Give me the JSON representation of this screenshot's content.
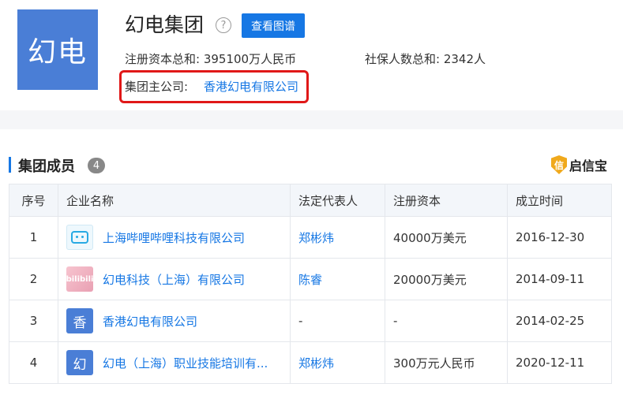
{
  "header": {
    "logo_text": "幻电",
    "title": "幻电集团",
    "graph_button": "查看图谱",
    "registered_capital": "注册资本总和: 395100万人民币",
    "social_insurance": "社保人数总和: 2342人",
    "parent_label": "集团主公司:",
    "parent_company": "香港幻电有限公司",
    "highlight_color": "#e01818"
  },
  "section": {
    "title": "集团成员",
    "count": "4",
    "brand_glyph": "信",
    "brand": "启信宝"
  },
  "table": {
    "headers": [
      "序号",
      "企业名称",
      "法定代表人",
      "注册资本",
      "成立时间"
    ],
    "rows": [
      {
        "num": "1",
        "logo_text": "",
        "name": "上海哔哩哔哩科技有限公司",
        "rep": "郑彬炜",
        "capital": "40000万美元",
        "date": "2016-12-30"
      },
      {
        "num": "2",
        "logo_text": "bilibili",
        "name": "幻电科技（上海）有限公司",
        "rep": "陈睿",
        "capital": "20000万美元",
        "date": "2014-09-11"
      },
      {
        "num": "3",
        "logo_text": "香",
        "name": "香港幻电有限公司",
        "rep": "-",
        "capital": "-",
        "date": "2014-02-25"
      },
      {
        "num": "4",
        "logo_text": "幻",
        "name": "幻电（上海）职业技能培训有...",
        "rep": "郑彬炜",
        "capital": "300万元人民币",
        "date": "2020-12-11"
      }
    ]
  }
}
